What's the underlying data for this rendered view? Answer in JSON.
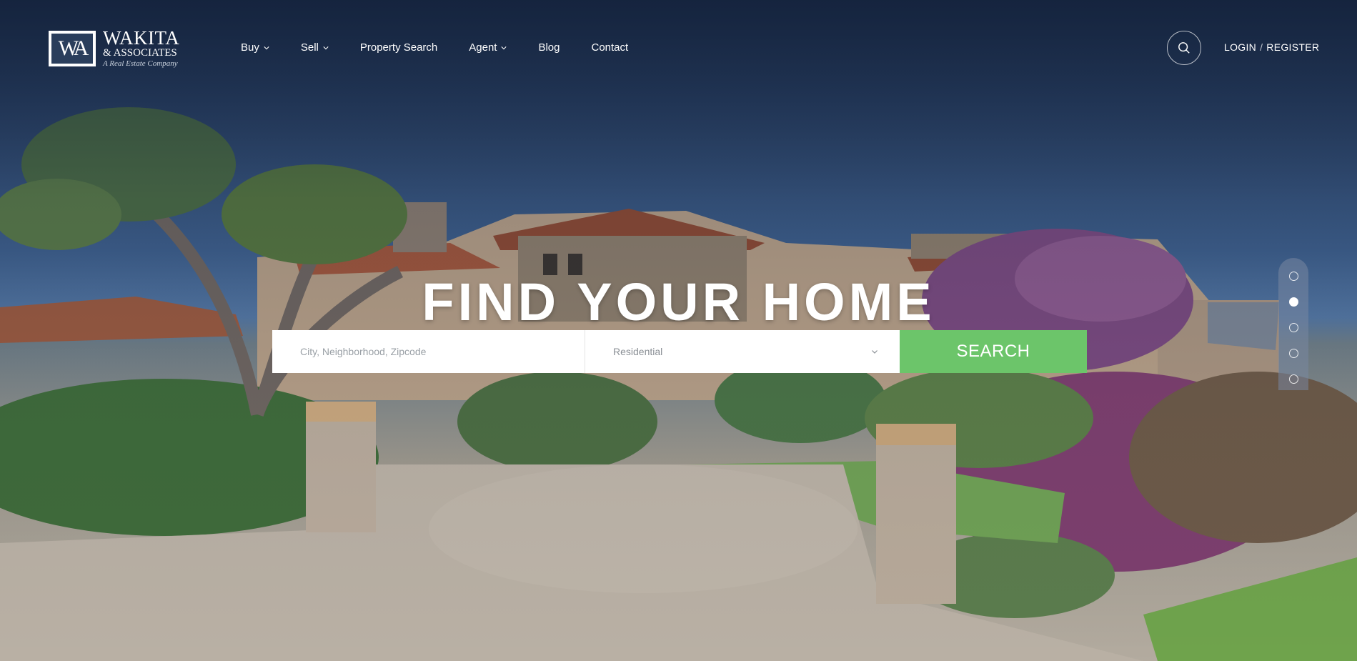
{
  "brand": {
    "monogram": "WA",
    "name": "WAKITA",
    "sub": "& ASSOCIATES",
    "tagline": "A Real Estate Company"
  },
  "nav": {
    "items": [
      {
        "label": "Buy",
        "dropdown": true
      },
      {
        "label": "Sell",
        "dropdown": true
      },
      {
        "label": "Property Search",
        "dropdown": false
      },
      {
        "label": "Agent",
        "dropdown": true
      },
      {
        "label": "Blog",
        "dropdown": false
      },
      {
        "label": "Contact",
        "dropdown": false
      }
    ]
  },
  "header": {
    "search_icon": "search-icon",
    "login_label": "LOGIN",
    "separator": "/",
    "register_label": "REGISTER"
  },
  "hero": {
    "title": "FIND YOUR HOME"
  },
  "search": {
    "placeholder": "City, Neighborhood, Zipcode",
    "value": "",
    "property_type": "Residential",
    "button_label": "SEARCH"
  },
  "slider": {
    "count": 5,
    "active_index": 1
  },
  "colors": {
    "accent": "#6cc56a",
    "header_bg": "#1b2b47"
  }
}
